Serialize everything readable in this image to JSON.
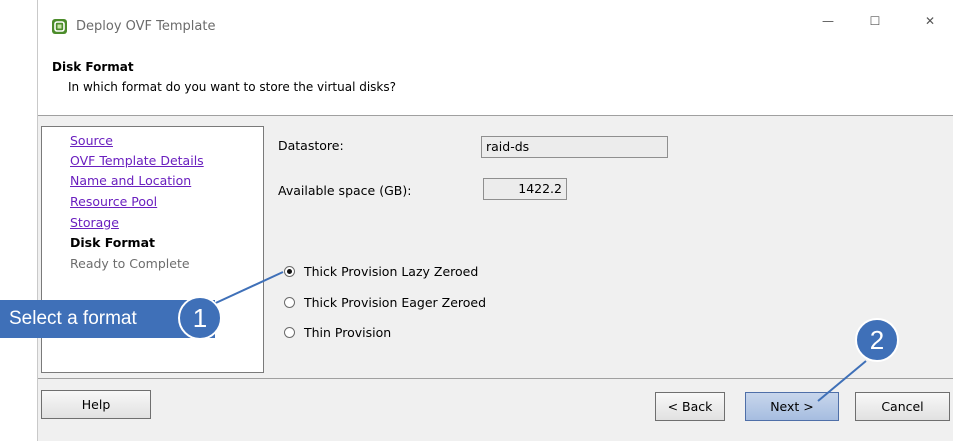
{
  "window": {
    "title": "Deploy OVF Template",
    "icon": "ovf-app-icon",
    "controls": {
      "minimize": "—",
      "maximize": "☐",
      "close": "✕"
    }
  },
  "header": {
    "title": "Disk Format",
    "subtitle": "In which format do you want to store the virtual disks?"
  },
  "steps": [
    {
      "label": "Source",
      "state": "link"
    },
    {
      "label": "OVF Template Details",
      "state": "link"
    },
    {
      "label": "Name and Location",
      "state": "link"
    },
    {
      "label": "Resource Pool",
      "state": "link"
    },
    {
      "label": "Storage",
      "state": "link"
    },
    {
      "label": "Disk Format",
      "state": "current"
    },
    {
      "label": "Ready to Complete",
      "state": "future"
    }
  ],
  "datastore": {
    "label": "Datastore:",
    "value": "raid-ds"
  },
  "space": {
    "label": "Available space (GB):",
    "value": "1422.2"
  },
  "formats": [
    {
      "label": "Thick Provision Lazy Zeroed",
      "selected": true
    },
    {
      "label": "Thick Provision Eager Zeroed",
      "selected": false
    },
    {
      "label": "Thin Provision",
      "selected": false
    }
  ],
  "buttons": {
    "help": "Help",
    "back": "< Back",
    "next": "Next >",
    "cancel": "Cancel"
  },
  "annotations": {
    "callout_text": "Select a format",
    "badge1": "1",
    "badge2": "2"
  },
  "colors": {
    "accent": "#3f70b8",
    "link": "#6a1fbf",
    "primary_button": "#b4c8e6"
  }
}
